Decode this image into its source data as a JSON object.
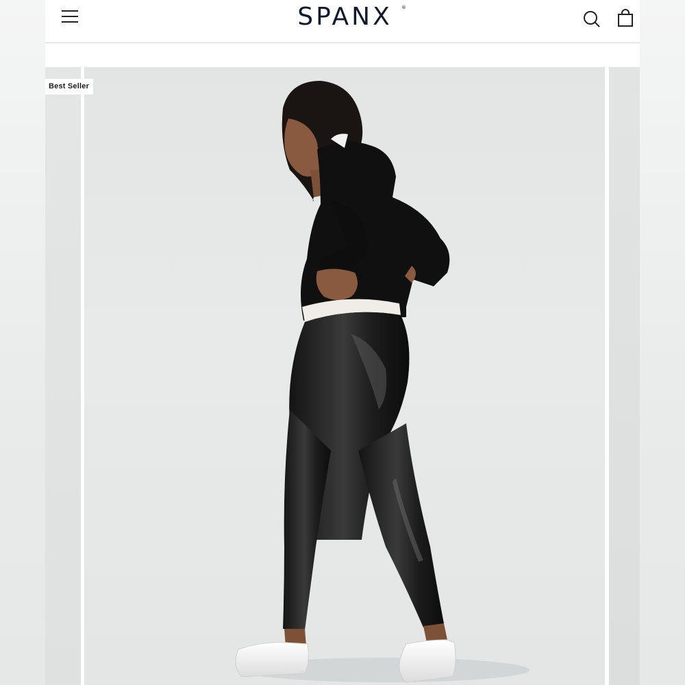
{
  "header": {
    "brand": "SPANX",
    "brand_mark": "®",
    "menu_icon": "hamburger-menu-icon",
    "search_icon": "search-icon",
    "cart_icon": "shopping-bag-icon"
  },
  "product_carousel": {
    "badge": "Best Seller",
    "image_subject": "product-photo-faux-leather-leggings"
  },
  "colors": {
    "brand_text": "#111a2c",
    "background": "#ffffff",
    "photo_backdrop": "#e5e7e7"
  }
}
